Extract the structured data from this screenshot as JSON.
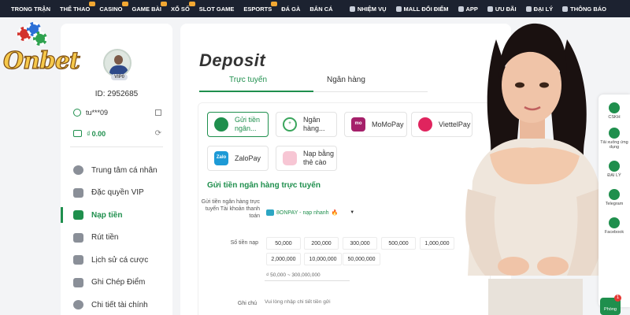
{
  "topnav": {
    "left": [
      "TRONG TRẬN",
      "THỂ THAO",
      "CASINO",
      "GAME BÀI",
      "XỔ SỐ",
      "SLOT GAME",
      "ESPORTS",
      "ĐÁ GÀ",
      "BẮN CÁ"
    ],
    "right": [
      "NHIỆM VỤ",
      "MALL ĐỔI ĐIỂM",
      "APP",
      "ƯU ĐÃI",
      "ĐẠI LÝ",
      "THÔNG BÁO"
    ]
  },
  "logo": {
    "text": "Onbet"
  },
  "profile": {
    "vip": "VIP0",
    "id": "ID: 2952685",
    "username": "tu***09",
    "currency": "₫",
    "balance": "0.00"
  },
  "menu": [
    {
      "label": "Trung tâm cá nhân",
      "icon": "user-icon"
    },
    {
      "label": "Đặc quyền VIP",
      "icon": "crown-icon"
    },
    {
      "label": "Nạp tiền",
      "icon": "deposit-icon",
      "active": true
    },
    {
      "label": "Rút tiền",
      "icon": "card-icon"
    },
    {
      "label": "Lịch sử cá cược",
      "icon": "history-icon"
    },
    {
      "label": "Ghi Chép Điểm",
      "icon": "points-icon"
    },
    {
      "label": "Chi tiết tài chính",
      "icon": "finance-icon"
    }
  ],
  "deposit": {
    "title": "Deposit",
    "tabs": [
      "Trực tuyến",
      "Ngân hàng"
    ],
    "methods": [
      {
        "label": "Gửi tiền\nngân...",
        "icon_color": "#1f8f4d",
        "icon_text": "",
        "selected": true
      },
      {
        "label": "Ngân\nhàng...",
        "icon_color": "#3aa55c",
        "icon_text": "+",
        "selected": false
      },
      {
        "label": "MoMoPay",
        "icon_color": "#a5206a",
        "icon_text": "mo",
        "selected": false
      },
      {
        "label": "ViettelPay",
        "icon_color": "#e0245e",
        "icon_text": "",
        "selected": false
      },
      {
        "label": "ZaloPay",
        "icon_color": "#1d9ad6",
        "icon_text": "Zalo",
        "selected": false
      },
      {
        "label": "Nạp bằng\nthẻ cào",
        "icon_color": "#d84a78",
        "icon_text": "",
        "selected": false
      }
    ],
    "section_title": "Gửi tiền ngân hàng trực tuyến",
    "bank_label": "Gửi tiền ngân hàng trực tuyến Tài khoản thanh toán",
    "bank_value": "8ONPAY - nạp nhanh",
    "amount_label": "Số tiền nạp",
    "amounts": [
      "50,000",
      "200,000",
      "300,000",
      "500,000",
      "1,000,000",
      "2,000,000",
      "10,000,000",
      "50,000,000"
    ],
    "range": "₫ 50,000 ~ 300,000,000",
    "note_label": "Ghi chú",
    "note_placeholder": "Vui lòng nhập chi tiết tiền gửi"
  },
  "rail": {
    "items": [
      "CSKH",
      "Tải xuống ứng dụng",
      "ĐẠI LÝ",
      "Telegram",
      "Facebook"
    ],
    "room": "Phòng",
    "room_badge": "1"
  },
  "colors": {
    "accent": "#1f8f4d",
    "nav_bg": "#1c2230"
  }
}
